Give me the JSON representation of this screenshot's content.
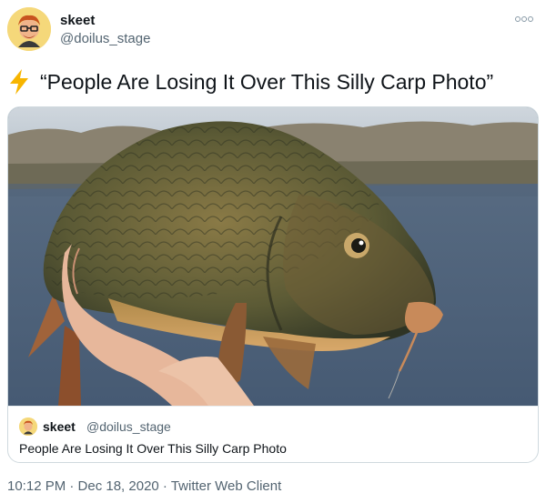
{
  "author": {
    "display_name": "skeet",
    "handle": "@doilus_stage"
  },
  "tweet": {
    "icon": "lightning-bolt-icon",
    "text": "“People Are Losing It Over This Silly Carp Photo”"
  },
  "card": {
    "image_icon": "carp-photo",
    "author_name": "skeet",
    "author_handle": "@doilus_stage",
    "text": "People Are Losing It Over This Silly Carp Photo"
  },
  "footer": {
    "timestamp": "10:12 PM · Dec 18, 2020 · Twitter Web Client"
  },
  "colors": {
    "text_primary": "#0f1419",
    "text_secondary": "#536471",
    "border": "#cfd9de",
    "bolt": "#f7b500"
  }
}
